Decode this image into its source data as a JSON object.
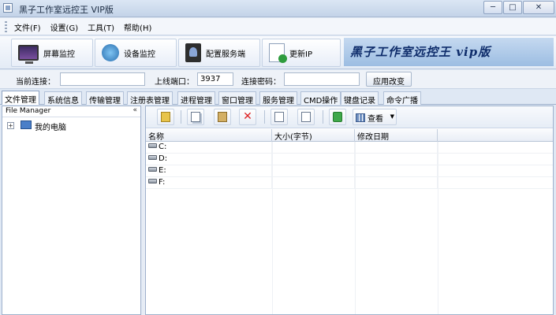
{
  "window": {
    "title": "黑子工作室远控王 VIP版",
    "buttons": [
      "─",
      "□",
      "✕"
    ]
  },
  "menu": [
    "文件(F)",
    "设置(G)",
    "工具(T)",
    "帮助(H)"
  ],
  "toolbar": {
    "buttons": [
      {
        "label": "屏幕监控",
        "icon": "monitor-icon"
      },
      {
        "label": "设备监控",
        "icon": "camera-icon"
      },
      {
        "label": "配置服务端",
        "icon": "config-icon"
      },
      {
        "label": "更新IP",
        "icon": "update-icon"
      }
    ],
    "brand": "黑子工作室远控王  vip版"
  },
  "connection": {
    "current_label": "当前连接：",
    "current_value": "",
    "port_label": "上线端口：",
    "port_value": "3937",
    "password_label": "连接密码：",
    "password_value": "",
    "apply_label": "应用改变"
  },
  "tabs": [
    "文件管理",
    "系统信息",
    "传输管理",
    "注册表管理",
    "进程管理",
    "窗口管理",
    "服务管理",
    "CMD操作",
    "键盘记录",
    "命令广播"
  ],
  "file_manager": {
    "title": "File Manager",
    "collapse": "«",
    "tree": [
      {
        "expander": "+",
        "label": "我的电脑"
      }
    ],
    "view_label": "查看",
    "columns": [
      "名称",
      "大小(字节)",
      "修改日期"
    ],
    "rows": [
      {
        "name": "C:",
        "size": "",
        "date": ""
      },
      {
        "name": "D:",
        "size": "",
        "date": ""
      },
      {
        "name": "E:",
        "size": "",
        "date": ""
      },
      {
        "name": "F:",
        "size": "",
        "date": ""
      }
    ]
  }
}
